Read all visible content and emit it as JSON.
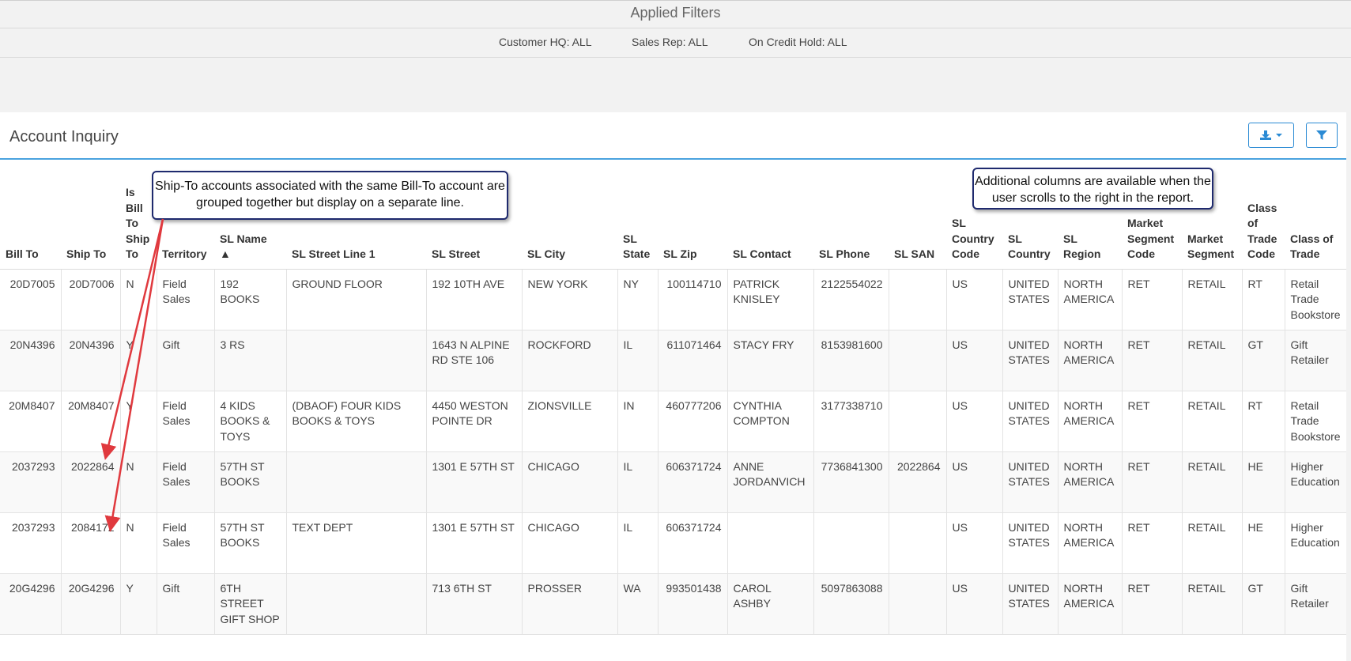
{
  "filters": {
    "title": "Applied Filters",
    "items": [
      {
        "label": "Customer HQ:",
        "value": "ALL"
      },
      {
        "label": "Sales Rep:",
        "value": "ALL"
      },
      {
        "label": "On Credit Hold:",
        "value": "ALL"
      }
    ]
  },
  "panel": {
    "title": "Account Inquiry",
    "download_icon": "download-icon",
    "filter_icon": "filter-icon",
    "accent_color": "#2a8ad4"
  },
  "callouts": {
    "ship_to": "Ship-To accounts associated with the same Bill-To account are grouped together  but display on a separate line.",
    "additional_columns": "Additional columns are available when the user scrolls to the right in the report."
  },
  "table": {
    "columns": [
      "Bill To",
      "Ship To",
      "Is Bill To Ship To",
      "Territory",
      "SL Name ▲",
      "SL Street Line 1",
      "SL Street",
      "SL City",
      "SL State",
      "SL Zip",
      "SL Contact",
      "SL Phone",
      "SL SAN",
      "SL Country Code",
      "SL Country",
      "SL Region",
      "Market Segment Code",
      "Market Segment",
      "Class of Trade Code",
      "Class of Trade"
    ],
    "rows": [
      [
        "20D7005",
        "20D7006",
        "N",
        "Field Sales",
        "192 BOOKS",
        "GROUND FLOOR",
        "192 10TH AVE",
        "NEW YORK",
        "NY",
        "100114710",
        "PATRICK KNISLEY",
        "2122554022",
        "",
        "US",
        "UNITED STATES",
        "NORTH AMERICA",
        "RET",
        "RETAIL",
        "RT",
        "Retail Trade Bookstore"
      ],
      [
        "20N4396",
        "20N4396",
        "Y",
        "Gift",
        "3 RS",
        "",
        "1643 N ALPINE RD STE 106",
        "ROCKFORD",
        "IL",
        "611071464",
        "STACY FRY",
        "8153981600",
        "",
        "US",
        "UNITED STATES",
        "NORTH AMERICA",
        "RET",
        "RETAIL",
        "GT",
        "Gift Retailer"
      ],
      [
        "20M8407",
        "20M8407",
        "Y",
        "Field Sales",
        "4 KIDS BOOKS & TOYS",
        "(DBAOF) FOUR KIDS BOOKS & TOYS",
        "4450 WESTON POINTE DR",
        "ZIONSVILLE",
        "IN",
        "460777206",
        "CYNTHIA COMPTON",
        "3177338710",
        "",
        "US",
        "UNITED STATES",
        "NORTH AMERICA",
        "RET",
        "RETAIL",
        "RT",
        "Retail Trade Bookstore"
      ],
      [
        "2037293",
        "2022864",
        "N",
        "Field Sales",
        "57TH ST BOOKS",
        "",
        "1301 E 57TH ST",
        "CHICAGO",
        "IL",
        "606371724",
        "ANNE JORDANVICH",
        "7736841300",
        "2022864",
        "US",
        "UNITED STATES",
        "NORTH AMERICA",
        "RET",
        "RETAIL",
        "HE",
        "Higher Education"
      ],
      [
        "2037293",
        "2084172",
        "N",
        "Field Sales",
        "57TH ST BOOKS",
        "TEXT DEPT",
        "1301 E 57TH ST",
        "CHICAGO",
        "IL",
        "606371724",
        "",
        "",
        "",
        "US",
        "UNITED STATES",
        "NORTH AMERICA",
        "RET",
        "RETAIL",
        "HE",
        "Higher Education"
      ],
      [
        "20G4296",
        "20G4296",
        "Y",
        "Gift",
        "6TH STREET GIFT SHOP",
        "",
        "713 6TH ST",
        "PROSSER",
        "WA",
        "993501438",
        "CAROL ASHBY",
        "5097863088",
        "",
        "US",
        "UNITED STATES",
        "NORTH AMERICA",
        "RET",
        "RETAIL",
        "GT",
        "Gift Retailer"
      ]
    ]
  }
}
